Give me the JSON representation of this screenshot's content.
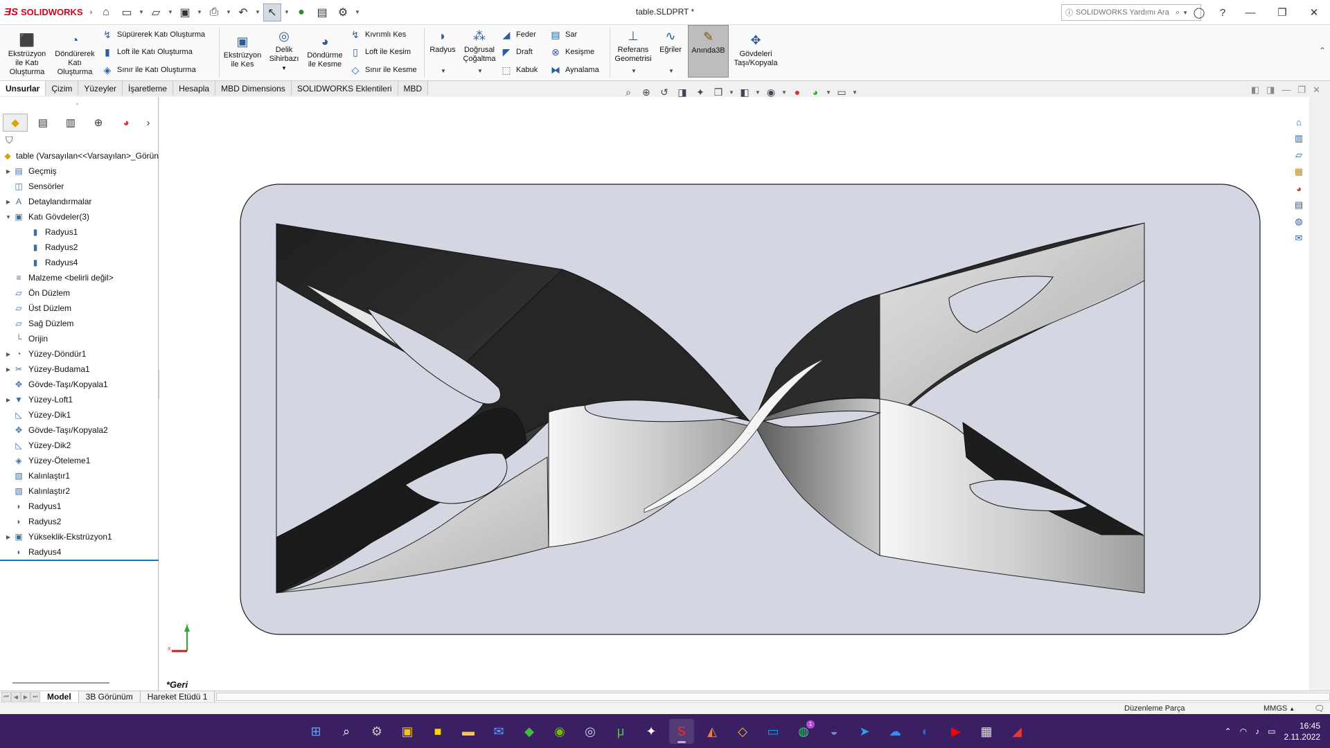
{
  "app": {
    "brand": "SOLIDWORKS",
    "document_title": "table.SLDPRT *",
    "search_placeholder": "SOLIDWORKS Yardımı Ara"
  },
  "ribbon": {
    "large_buttons": [
      {
        "id": "extrude-boss",
        "label": "Ekstrüzyon ile Katı Oluşturma",
        "icon": "extrude-boss-icon"
      },
      {
        "id": "revolve-boss",
        "label": "Döndürerek Katı Oluşturma",
        "icon": "revolve-boss-icon"
      },
      {
        "id": "extrude-cut",
        "label": "Ekstrüzyon ile Kes",
        "icon": "extrude-cut-icon"
      },
      {
        "id": "hole-wizard",
        "label": "Delik Sihirbazı",
        "icon": "hole-wizard-icon"
      },
      {
        "id": "revolve-cut",
        "label": "Döndürme ile Kesme",
        "icon": "revolve-cut-icon"
      },
      {
        "id": "fillet",
        "label": "Radyus",
        "icon": "fillet-icon"
      },
      {
        "id": "linear-pattern",
        "label": "Doğrusal Çoğaltma",
        "icon": "linear-pattern-icon"
      },
      {
        "id": "ref-geometry",
        "label": "Referans Geometrisi",
        "icon": "reference-geometry-icon"
      },
      {
        "id": "curves",
        "label": "Eğriler",
        "icon": "curves-icon"
      },
      {
        "id": "instant3d",
        "label": "Anında3B",
        "icon": "instant3d-icon"
      },
      {
        "id": "move-copy-bodies",
        "label": "Gövdeleri Taşı/Kopyala",
        "icon": "move-copy-icon"
      }
    ],
    "small_buttons": [
      {
        "id": "swept-boss",
        "label": "Süpürerek Katı Oluşturma",
        "icon": "swept-boss-icon"
      },
      {
        "id": "loft-boss",
        "label": "Loft ile Katı Oluşturma",
        "icon": "loft-boss-icon"
      },
      {
        "id": "boundary-boss",
        "label": "Sınır ile Katı Oluşturma",
        "icon": "boundary-boss-icon"
      },
      {
        "id": "swept-cut",
        "label": "Kıvrımlı Kes",
        "icon": "swept-cut-icon"
      },
      {
        "id": "loft-cut",
        "label": "Loft ile Kesim",
        "icon": "loft-cut-icon"
      },
      {
        "id": "boundary-cut",
        "label": "Sınır ile Kesme",
        "icon": "boundary-cut-icon"
      },
      {
        "id": "rib",
        "label": "Feder",
        "icon": "rib-icon"
      },
      {
        "id": "draft",
        "label": "Draft",
        "icon": "draft-icon"
      },
      {
        "id": "shell",
        "label": "Kabuk",
        "icon": "shell-icon"
      },
      {
        "id": "wrap",
        "label": "Sar",
        "icon": "wrap-icon"
      },
      {
        "id": "intersect",
        "label": "Kesişme",
        "icon": "intersect-icon"
      },
      {
        "id": "mirror",
        "label": "Aynalama",
        "icon": "mirror-icon"
      }
    ]
  },
  "cm_tabs": [
    "Unsurlar",
    "Çizim",
    "Yüzeyler",
    "İşaretleme",
    "Hesapla",
    "MBD Dimensions",
    "SOLIDWORKS Eklentileri",
    "MBD"
  ],
  "active_cm_tab": "Unsurlar",
  "tree": {
    "root": "table  (Varsayılan<<Varsayılan>_Görün",
    "nodes": [
      {
        "label": "Geçmiş",
        "expandable": true,
        "indent": 0,
        "icon": "history-icon"
      },
      {
        "label": "Sensörler",
        "expandable": false,
        "indent": 0,
        "icon": "sensors-icon"
      },
      {
        "label": "Detaylandırmalar",
        "expandable": true,
        "indent": 0,
        "icon": "annotations-icon"
      },
      {
        "label": "Katı Gövdeler(3)",
        "expandable": true,
        "expanded": true,
        "indent": 0,
        "icon": "solid-bodies-folder-icon"
      },
      {
        "label": "Radyus1",
        "expandable": false,
        "indent": 1,
        "icon": "solid-body-icon"
      },
      {
        "label": "Radyus2",
        "expandable": false,
        "indent": 1,
        "icon": "solid-body-icon"
      },
      {
        "label": "Radyus4",
        "expandable": false,
        "indent": 1,
        "icon": "solid-body-icon"
      },
      {
        "label": "Malzeme <belirli değil>",
        "expandable": false,
        "indent": 0,
        "icon": "material-icon"
      },
      {
        "label": "Ön Düzlem",
        "expandable": false,
        "indent": 0,
        "icon": "plane-icon"
      },
      {
        "label": "Üst Düzlem",
        "expandable": false,
        "indent": 0,
        "icon": "plane-icon"
      },
      {
        "label": "Sağ Düzlem",
        "expandable": false,
        "indent": 0,
        "icon": "plane-icon"
      },
      {
        "label": "Orijin",
        "expandable": false,
        "indent": 0,
        "icon": "origin-icon"
      },
      {
        "label": "Yüzey-Döndür1",
        "expandable": true,
        "indent": 0,
        "icon": "surface-revolve-icon"
      },
      {
        "label": "Yüzey-Budama1",
        "expandable": true,
        "indent": 0,
        "icon": "surface-trim-icon"
      },
      {
        "label": "Gövde-Taşı/Kopyala1",
        "expandable": false,
        "indent": 0,
        "icon": "move-copy-icon"
      },
      {
        "label": "Yüzey-Loft1",
        "expandable": true,
        "indent": 0,
        "icon": "surface-loft-icon"
      },
      {
        "label": "Yüzey-Dik1",
        "expandable": false,
        "indent": 0,
        "icon": "surface-ruled-icon"
      },
      {
        "label": "Gövde-Taşı/Kopyala2",
        "expandable": false,
        "indent": 0,
        "icon": "move-copy-icon"
      },
      {
        "label": "Yüzey-Dik2",
        "expandable": false,
        "indent": 0,
        "icon": "surface-ruled-icon"
      },
      {
        "label": "Yüzey-Öteleme1",
        "expandable": false,
        "indent": 0,
        "icon": "surface-offset-icon"
      },
      {
        "label": "Kalınlaştır1",
        "expandable": false,
        "indent": 0,
        "icon": "thicken-icon"
      },
      {
        "label": "Kalınlaştır2",
        "expandable": false,
        "indent": 0,
        "icon": "thicken-icon"
      },
      {
        "label": "Radyus1",
        "expandable": false,
        "indent": 0,
        "icon": "fillet-icon"
      },
      {
        "label": "Radyus2",
        "expandable": false,
        "indent": 0,
        "icon": "fillet-icon"
      },
      {
        "label": "Yükseklik-Ekstrüzyon1",
        "expandable": true,
        "indent": 0,
        "icon": "boss-extrude-icon"
      },
      {
        "label": "Radyus4",
        "expandable": false,
        "indent": 0,
        "icon": "fillet-icon"
      }
    ]
  },
  "viewport": {
    "back_label": "*Geri",
    "background_color": "#ffffff",
    "panel_color": "#d4d6e1",
    "triad_labels": {
      "y": "Y",
      "x": "X"
    }
  },
  "bottom_tabs": [
    "Model",
    "3B Görünüm",
    "Hareket Etüdü 1"
  ],
  "active_bottom_tab": "Model",
  "status": {
    "mode": "Düzenleme Parça",
    "units": "MMGS",
    "units_arrow": "▲"
  },
  "taskbar": {
    "time": "16:45",
    "date": "2.11.2022",
    "whatsapp_badge": "1",
    "apps": [
      "start",
      "search",
      "settings",
      "store",
      "sticky-notes",
      "file-explorer",
      "mail",
      "xbox",
      "nvidia",
      "steam",
      "utorrent",
      "epic",
      "solidworks",
      "matlab",
      "binance",
      "prime-video",
      "whatsapp",
      "discord",
      "telegram",
      "onedrive",
      "edge",
      "youtube",
      "calculator",
      "gaming"
    ]
  }
}
